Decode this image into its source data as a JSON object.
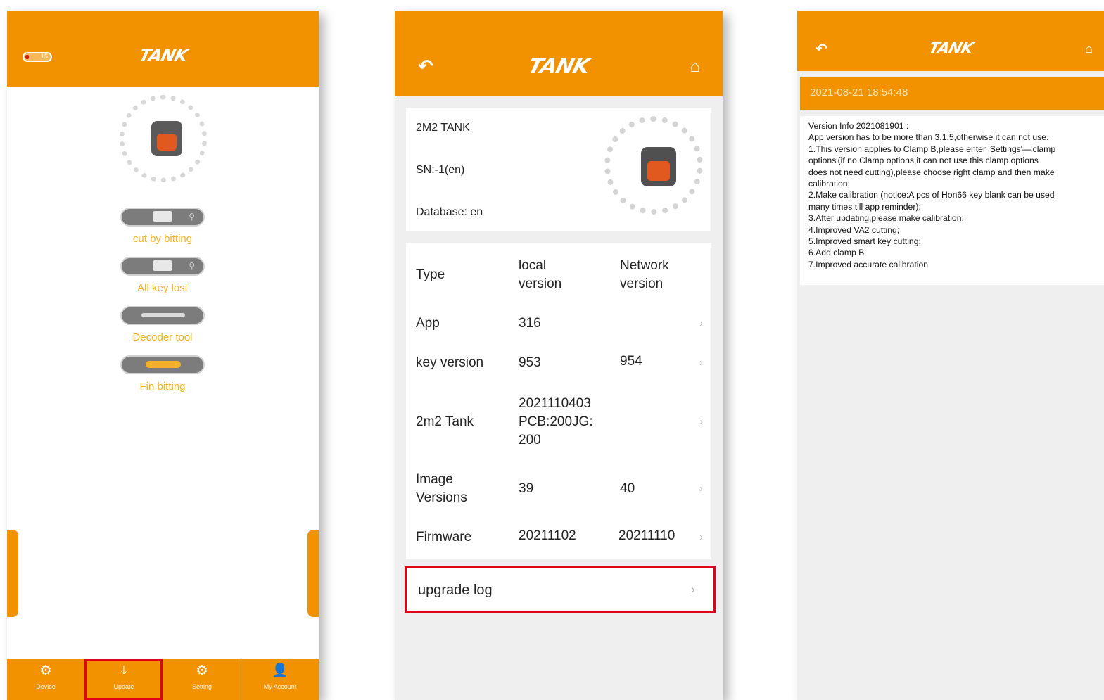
{
  "brand": "TANK",
  "colors": {
    "orange": "#f39200",
    "highlight_red": "#e3001b",
    "label_yellow": "#f5b21d"
  },
  "screen1": {
    "battery_text": "15",
    "menu": [
      {
        "label": "cut by bitting",
        "icon": "key-cut-icon"
      },
      {
        "label": "All key lost",
        "icon": "lock-icon"
      },
      {
        "label": "Decoder tool",
        "icon": "decoder-icon"
      },
      {
        "label": "Fin bitting",
        "icon": "key-icon"
      }
    ],
    "tabs": [
      {
        "label": "Device",
        "icon": "device-icon",
        "glyph": "⚙"
      },
      {
        "label": "Update",
        "icon": "download-icon",
        "glyph": "⤓"
      },
      {
        "label": "Setting",
        "icon": "gear-icon",
        "glyph": "⚙"
      },
      {
        "label": "My Account",
        "icon": "account-icon",
        "glyph": "👤"
      }
    ]
  },
  "screen2": {
    "device_name": "2M2 TANK",
    "sn": "SN:-1(en)",
    "database": "Database: en",
    "headers": {
      "type": "Type",
      "local": "local\nversion",
      "network": "Network\nversion"
    },
    "rows": [
      {
        "type": "App",
        "local": "316",
        "network": ""
      },
      {
        "type": "key version",
        "local": "953",
        "network": "954"
      },
      {
        "type": "2m2 Tank",
        "local": "2021110403\nPCB:200JG:\n200",
        "network": ""
      },
      {
        "type": "Image\nVersions",
        "local": "39",
        "network": "40"
      },
      {
        "type": "Firmware",
        "local": "20211102",
        "network": "20211110"
      }
    ],
    "upgrade_log": "upgrade log"
  },
  "screen3": {
    "date": "2021-08-21 18:54:48",
    "log_lines": [
      "Version Info 2021081901 :",
      "App version has to be more than 3.1.5,otherwise it can not use.",
      "1.This version applies to Clamp B,please enter 'Settings'—'clamp",
      "options'(if no   Clamp options,it can not use this clamp options",
      "does not need cutting),please choose right clamp and then make",
      "calibration;",
      "2.Make calibration (notice:A pcs of Hon66 key blank can be used",
      "many times till app reminder);",
      "3.After updating,please make calibration;",
      "4.Improved VA2 cutting;",
      "5.Improved smart key cutting;",
      "6.Add clamp B",
      "7.Improved accurate calibration"
    ]
  }
}
